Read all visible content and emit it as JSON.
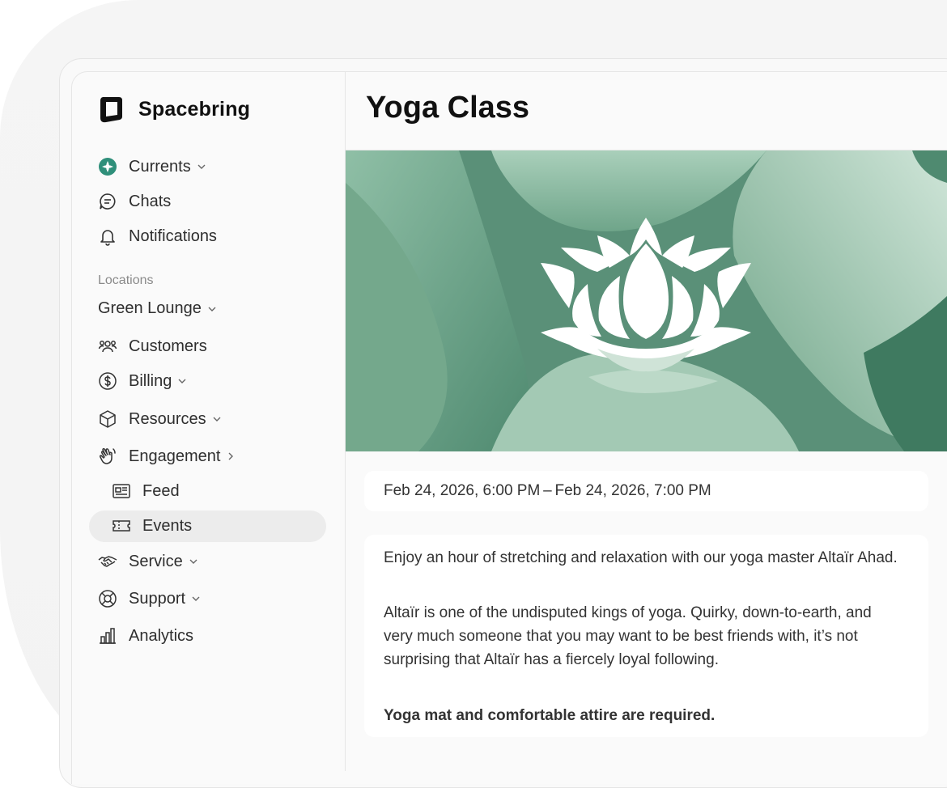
{
  "brand": {
    "name": "Spacebring"
  },
  "sidebar": {
    "top_items": [
      {
        "label": "Currents",
        "icon": "currents-icon",
        "has_chevron": true
      },
      {
        "label": "Chats",
        "icon": "chat-icon"
      },
      {
        "label": "Notifications",
        "icon": "bell-icon"
      }
    ],
    "section_label": "Locations",
    "location": "Green Lounge",
    "items": [
      {
        "label": "Customers",
        "icon": "users-icon"
      },
      {
        "label": "Billing",
        "icon": "dollar-icon",
        "has_chevron": true
      },
      {
        "label": "Resources",
        "icon": "cube-icon",
        "has_chevron": true
      },
      {
        "label": "Engagement",
        "icon": "wave-hand-icon",
        "chevron": "right"
      },
      {
        "label": "Feed",
        "icon": "newspaper-icon",
        "sub": true
      },
      {
        "label": "Events",
        "icon": "ticket-icon",
        "sub": true,
        "active": true
      },
      {
        "label": "Service",
        "icon": "handshake-icon",
        "has_chevron": true
      },
      {
        "label": "Support",
        "icon": "lifebuoy-icon",
        "has_chevron": true
      },
      {
        "label": "Analytics",
        "icon": "bar-chart-icon"
      }
    ]
  },
  "event": {
    "title": "Yoga Class",
    "date_range": "Feb 24, 2026, 6:00 PM – Feb 24, 2026, 7:00 PM",
    "description_1": "Enjoy an hour of stretching and relaxation with our yoga master Altaïr Ahad.",
    "description_2": "Altaïr is one of the undisputed kings of yoga. Quirky, down-to-earth, and very much someone that you may want to be best friends with, it’s not surprising that Altaïr has a fiercely loyal following.",
    "requirement": "Yoga mat and comfortable attire are required."
  },
  "colors": {
    "accent": "#2f8f7a",
    "hero": "#5a9078"
  }
}
